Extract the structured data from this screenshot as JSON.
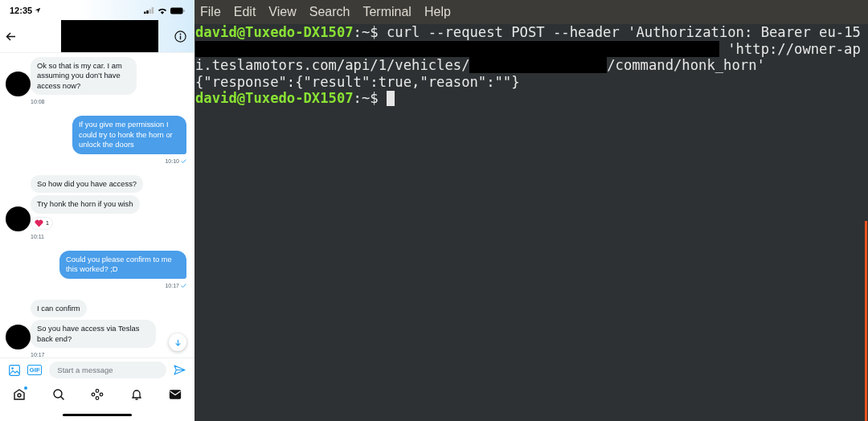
{
  "phone": {
    "status_bar": {
      "time": "12:35"
    },
    "messages": [
      {
        "kind": "received",
        "bubbles": [
          "Ok so that is my car. I am assuming you don’t have access now?"
        ],
        "time": "10:08",
        "read": false
      },
      {
        "kind": "sent",
        "bubbles": [
          "If you give me permission I could try to honk the horn or unlock the doors"
        ],
        "time": "10:10",
        "read": true
      },
      {
        "kind": "received",
        "bubbles": [
          "So how did you have access?",
          "Try honk the horn if you wish"
        ],
        "reaction": {
          "count": "1"
        },
        "time": "10:11",
        "read": false
      },
      {
        "kind": "sent",
        "bubbles": [
          "Could you please confirm to me this worked? ;D"
        ],
        "time": "10:17",
        "read": true
      },
      {
        "kind": "received",
        "bubbles": [
          "I can confirm",
          "So you have access via Teslas back end?"
        ],
        "time": "10:17",
        "read": false
      }
    ],
    "composer": {
      "placeholder": "Start a message",
      "gif": "GIF"
    },
    "tabs": [
      {
        "kind": "home",
        "selected": false,
        "notification": true
      },
      {
        "kind": "search",
        "selected": false,
        "notification": false
      },
      {
        "kind": "spaces",
        "selected": false,
        "notification": false
      },
      {
        "kind": "notifications",
        "selected": false,
        "notification": false
      },
      {
        "kind": "messages",
        "selected": true,
        "notification": false
      }
    ]
  },
  "terminal": {
    "menu": [
      "File",
      "Edit",
      "View",
      "Search",
      "Terminal",
      "Help"
    ],
    "lines": [
      {
        "segments": [
          {
            "kind": "prompt",
            "text": "david@Tuxedo-DX1507"
          },
          {
            "kind": "path",
            "text": ":~$"
          },
          {
            "kind": "text",
            "text": " curl --request POST --header 'Authorization: Bearer eu-15"
          }
        ],
        "cursor": false
      },
      {
        "segments": [
          {
            "kind": "redaction_fill"
          },
          {
            "kind": "text",
            "text": " 'http://owner-ap"
          }
        ],
        "cursor": false
      },
      {
        "segments": [
          {
            "kind": "text",
            "text": "i.teslamotors.com/api/1/vehicles/"
          },
          {
            "kind": "redaction"
          },
          {
            "kind": "text",
            "text": "/command/honk_horn'"
          }
        ],
        "cursor": false
      },
      {
        "segments": [
          {
            "kind": "text",
            "text": "{\"response\":{\"result\":true,\"reason\":\"\"}"
          }
        ],
        "cursor": false
      },
      {
        "segments": [
          {
            "kind": "prompt",
            "text": "david@Tuxedo-DX1507"
          },
          {
            "kind": "path",
            "text": ":~$"
          }
        ],
        "cursor": true
      }
    ]
  }
}
